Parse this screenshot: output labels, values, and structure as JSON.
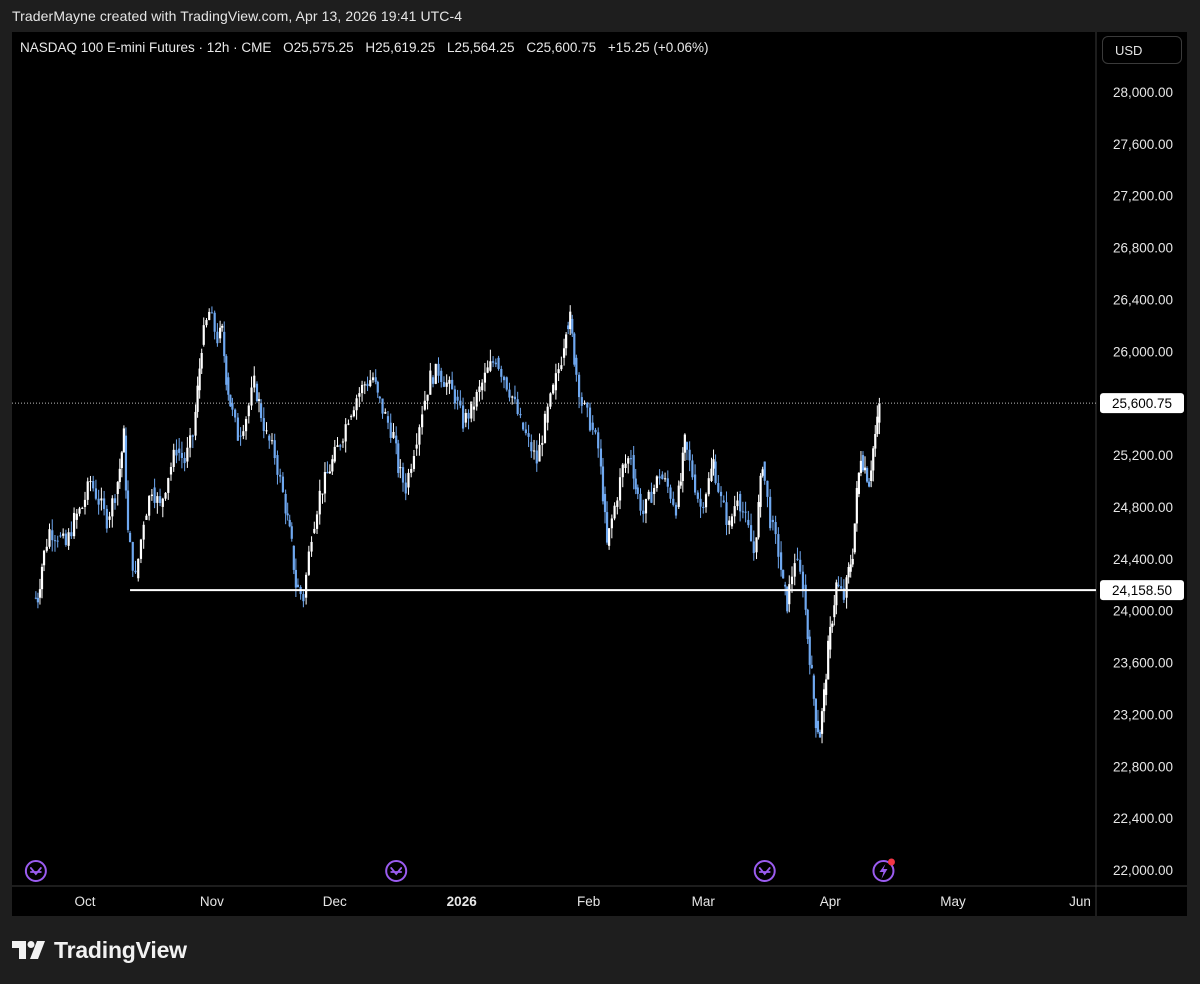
{
  "attribution": "TraderMayne created with TradingView.com, Apr 13, 2026 19:41 UTC-4",
  "legend": {
    "symbol": "NASDAQ 100 E-mini Futures · 12h · CME",
    "open": "O25,575.25",
    "high": "H25,619.25",
    "low": "L25,564.25",
    "close": "C25,600.75",
    "change": "+15.25 (+0.06%)"
  },
  "currency": "USD",
  "brand": "TradingView",
  "colors": {
    "background": "#000000",
    "up_candle": "#ffffff",
    "down_candle": "#6fa8f0",
    "price_line": "#ffffff",
    "event_icon": "#9b5cf0",
    "alert_dot": "#f23645"
  },
  "chart_data": {
    "type": "candlestick",
    "instrument": "NASDAQ 100 E-mini Futures",
    "timeframe": "12h",
    "y_axis_ticks": [
      28000,
      27600,
      27200,
      26800,
      26400,
      26000,
      25600,
      25200,
      24800,
      24400,
      24000,
      23600,
      23200,
      22800,
      22400,
      22000
    ],
    "y_axis_tick_labels": [
      "28,000.00",
      "27,600.00",
      "27,200.00",
      "26,800.00",
      "26,400.00",
      "26,000.00",
      "25,600.00",
      "25,200.00",
      "24,800.00",
      "24,400.00",
      "24,000.00",
      "23,600.00",
      "23,200.00",
      "22,800.00",
      "22,400.00",
      "22,000.00"
    ],
    "ylim": [
      21900,
      28400
    ],
    "x_axis_labels": [
      {
        "label": "Oct",
        "date": "2025-10-01",
        "bold": false
      },
      {
        "label": "Nov",
        "date": "2025-11-01",
        "bold": false
      },
      {
        "label": "Dec",
        "date": "2025-12-01",
        "bold": false
      },
      {
        "label": "2026",
        "date": "2026-01-01",
        "bold": true
      },
      {
        "label": "Feb",
        "date": "2026-02-01",
        "bold": false
      },
      {
        "label": "Mar",
        "date": "2026-03-01",
        "bold": false
      },
      {
        "label": "Apr",
        "date": "2026-04-01",
        "bold": false
      },
      {
        "label": "May",
        "date": "2026-05-01",
        "bold": false
      },
      {
        "label": "Jun",
        "date": "2026-06-01",
        "bold": false
      }
    ],
    "current_price": 25600.75,
    "current_price_label": "25,600.75",
    "horizontal_line": {
      "price": 24158.5,
      "label": "24,158.50",
      "start_date": "2025-10-12"
    },
    "close_series": [
      {
        "date": "2025-09-19",
        "close": 24100
      },
      {
        "date": "2025-09-20",
        "close": 24350
      },
      {
        "date": "2025-09-21",
        "close": 24620
      },
      {
        "date": "2025-09-23",
        "close": 24580
      },
      {
        "date": "2025-09-25",
        "close": 24500
      },
      {
        "date": "2025-09-27",
        "close": 24700
      },
      {
        "date": "2025-09-29",
        "close": 24800
      },
      {
        "date": "2025-10-01",
        "close": 25000
      },
      {
        "date": "2025-10-03",
        "close": 24850
      },
      {
        "date": "2025-10-05",
        "close": 24700
      },
      {
        "date": "2025-10-07",
        "close": 24900
      },
      {
        "date": "2025-10-09",
        "close": 25100
      },
      {
        "date": "2025-10-10",
        "close": 25350
      },
      {
        "date": "2025-10-11",
        "close": 24600
      },
      {
        "date": "2025-10-12",
        "close": 24250
      },
      {
        "date": "2025-10-14",
        "close": 24700
      },
      {
        "date": "2025-10-16",
        "close": 24950
      },
      {
        "date": "2025-10-18",
        "close": 24800
      },
      {
        "date": "2025-10-20",
        "close": 25050
      },
      {
        "date": "2025-10-22",
        "close": 25250
      },
      {
        "date": "2025-10-24",
        "close": 25150
      },
      {
        "date": "2025-10-26",
        "close": 25350
      },
      {
        "date": "2025-10-28",
        "close": 25700
      },
      {
        "date": "2025-10-29",
        "close": 26050
      },
      {
        "date": "2025-10-30",
        "close": 26300
      },
      {
        "date": "2025-11-01",
        "close": 26100
      },
      {
        "date": "2025-11-03",
        "close": 26150
      },
      {
        "date": "2025-11-04",
        "close": 25800
      },
      {
        "date": "2025-11-05",
        "close": 25600
      },
      {
        "date": "2025-11-06",
        "close": 25350
      },
      {
        "date": "2025-11-08",
        "close": 25500
      },
      {
        "date": "2025-11-10",
        "close": 25750
      },
      {
        "date": "2025-11-12",
        "close": 25600
      },
      {
        "date": "2025-11-13",
        "close": 25350
      },
      {
        "date": "2025-11-15",
        "close": 25200
      },
      {
        "date": "2025-11-17",
        "close": 24900
      },
      {
        "date": "2025-11-19",
        "close": 24700
      },
      {
        "date": "2025-11-20",
        "close": 24500
      },
      {
        "date": "2025-11-21",
        "close": 24200
      },
      {
        "date": "2025-11-22",
        "close": 24100
      },
      {
        "date": "2025-11-24",
        "close": 24600
      },
      {
        "date": "2025-11-26",
        "close": 24900
      },
      {
        "date": "2025-11-28",
        "close": 25150
      },
      {
        "date": "2025-12-01",
        "close": 25300
      },
      {
        "date": "2025-12-03",
        "close": 25500
      },
      {
        "date": "2025-12-05",
        "close": 25650
      },
      {
        "date": "2025-12-07",
        "close": 25750
      },
      {
        "date": "2025-12-09",
        "close": 25800
      },
      {
        "date": "2025-12-11",
        "close": 25650
      },
      {
        "date": "2025-12-12",
        "close": 25500
      },
      {
        "date": "2025-12-14",
        "close": 25350
      },
      {
        "date": "2025-12-16",
        "close": 25100
      },
      {
        "date": "2025-12-17",
        "close": 24950
      },
      {
        "date": "2025-12-19",
        "close": 25250
      },
      {
        "date": "2025-12-21",
        "close": 25550
      },
      {
        "date": "2025-12-23",
        "close": 25800
      },
      {
        "date": "2025-12-25",
        "close": 25850
      },
      {
        "date": "2025-12-27",
        "close": 25750
      },
      {
        "date": "2025-12-29",
        "close": 25650
      },
      {
        "date": "2025-12-31",
        "close": 25450
      },
      {
        "date": "2026-01-02",
        "close": 25550
      },
      {
        "date": "2026-01-04",
        "close": 25700
      },
      {
        "date": "2026-01-06",
        "close": 25850
      },
      {
        "date": "2026-01-08",
        "close": 25950
      },
      {
        "date": "2026-01-10",
        "close": 25800
      },
      {
        "date": "2026-01-12",
        "close": 25650
      },
      {
        "date": "2026-01-14",
        "close": 25450
      },
      {
        "date": "2026-01-16",
        "close": 25300
      },
      {
        "date": "2026-01-18",
        "close": 25150
      },
      {
        "date": "2026-01-20",
        "close": 25450
      },
      {
        "date": "2026-01-22",
        "close": 25700
      },
      {
        "date": "2026-01-24",
        "close": 25950
      },
      {
        "date": "2026-01-26",
        "close": 26200
      },
      {
        "date": "2026-01-27",
        "close": 26250
      },
      {
        "date": "2026-01-28",
        "close": 25950
      },
      {
        "date": "2026-01-29",
        "close": 25600
      },
      {
        "date": "2026-01-31",
        "close": 25450
      },
      {
        "date": "2026-02-02",
        "close": 25250
      },
      {
        "date": "2026-02-04",
        "close": 24900
      },
      {
        "date": "2026-02-05",
        "close": 24500
      },
      {
        "date": "2026-02-06",
        "close": 24800
      },
      {
        "date": "2026-02-08",
        "close": 25100
      },
      {
        "date": "2026-02-10",
        "close": 25200
      },
      {
        "date": "2026-02-12",
        "close": 24950
      },
      {
        "date": "2026-02-13",
        "close": 24750
      },
      {
        "date": "2026-02-15",
        "close": 24900
      },
      {
        "date": "2026-02-17",
        "close": 25050
      },
      {
        "date": "2026-02-19",
        "close": 24950
      },
      {
        "date": "2026-02-21",
        "close": 24800
      },
      {
        "date": "2026-02-23",
        "close": 25000
      },
      {
        "date": "2026-02-24",
        "close": 25300
      },
      {
        "date": "2026-02-25",
        "close": 25050
      },
      {
        "date": "2026-02-27",
        "close": 24800
      },
      {
        "date": "2026-03-01",
        "close": 25000
      },
      {
        "date": "2026-03-03",
        "close": 25150
      },
      {
        "date": "2026-03-04",
        "close": 24850
      },
      {
        "date": "2026-03-06",
        "close": 24650
      },
      {
        "date": "2026-03-08",
        "close": 24900
      },
      {
        "date": "2026-03-10",
        "close": 24700
      },
      {
        "date": "2026-03-12",
        "close": 24450
      },
      {
        "date": "2026-03-14",
        "close": 24800
      },
      {
        "date": "2026-03-15",
        "close": 25150
      },
      {
        "date": "2026-03-16",
        "close": 24700
      },
      {
        "date": "2026-03-18",
        "close": 24450
      },
      {
        "date": "2026-03-20",
        "close": 24200
      },
      {
        "date": "2026-03-21",
        "close": 24050
      },
      {
        "date": "2026-03-22",
        "close": 24400
      },
      {
        "date": "2026-03-24",
        "close": 24200
      },
      {
        "date": "2026-03-26",
        "close": 23800
      },
      {
        "date": "2026-03-27",
        "close": 23500
      },
      {
        "date": "2026-03-28",
        "close": 23150
      },
      {
        "date": "2026-03-29",
        "close": 23050
      },
      {
        "date": "2026-03-30",
        "close": 23350
      },
      {
        "date": "2026-03-31",
        "close": 23700
      },
      {
        "date": "2026-04-01",
        "close": 23950
      },
      {
        "date": "2026-04-02",
        "close": 24200
      },
      {
        "date": "2026-04-03",
        "close": 24100
      },
      {
        "date": "2026-04-05",
        "close": 24300
      },
      {
        "date": "2026-04-06",
        "close": 24450
      },
      {
        "date": "2026-04-07",
        "close": 24900
      },
      {
        "date": "2026-04-08",
        "close": 25200
      },
      {
        "date": "2026-04-09",
        "close": 25100
      },
      {
        "date": "2026-04-10",
        "close": 25000
      },
      {
        "date": "2026-04-11",
        "close": 25250
      },
      {
        "date": "2026-04-12",
        "close": 25450
      },
      {
        "date": "2026-04-13",
        "close": 25600
      }
    ],
    "event_markers": [
      {
        "date": "2025-09-19",
        "kind": "arrow"
      },
      {
        "date": "2025-12-16",
        "kind": "arrow"
      },
      {
        "date": "2026-03-16",
        "kind": "arrow"
      },
      {
        "date": "2026-04-14",
        "kind": "bolt",
        "alert": true
      }
    ]
  }
}
